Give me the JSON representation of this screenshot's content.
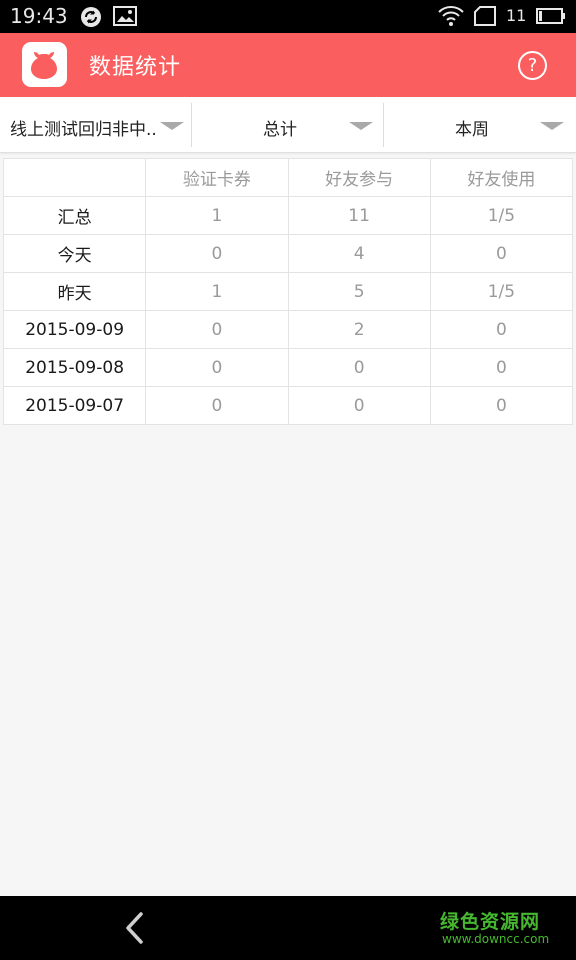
{
  "status_bar": {
    "time": "19:43",
    "battery_level": "11",
    "icons": [
      "sync-icon",
      "image-icon",
      "wifi-icon",
      "sim-icon",
      "battery-icon"
    ]
  },
  "app_bar": {
    "title": "数据统计",
    "help_label": "?",
    "color": "#fb5e5e"
  },
  "filters": [
    {
      "label": "线上测试回归非中.."
    },
    {
      "label": "总计"
    },
    {
      "label": "本周"
    }
  ],
  "table": {
    "headers": [
      "",
      "验证卡券",
      "好友参与",
      "好友使用"
    ],
    "rows": [
      {
        "label": "汇总",
        "values": [
          "1",
          "11",
          "1/5"
        ]
      },
      {
        "label": "今天",
        "values": [
          "0",
          "4",
          "0"
        ]
      },
      {
        "label": "昨天",
        "values": [
          "1",
          "5",
          "1/5"
        ]
      },
      {
        "label": "2015-09-09",
        "values": [
          "0",
          "2",
          "0"
        ]
      },
      {
        "label": "2015-09-08",
        "values": [
          "0",
          "0",
          "0"
        ]
      },
      {
        "label": "2015-09-07",
        "values": [
          "0",
          "0",
          "0"
        ]
      }
    ]
  },
  "watermark": {
    "title": "绿色资源网",
    "url": "www.downcc.com",
    "color": "#46b82f"
  }
}
